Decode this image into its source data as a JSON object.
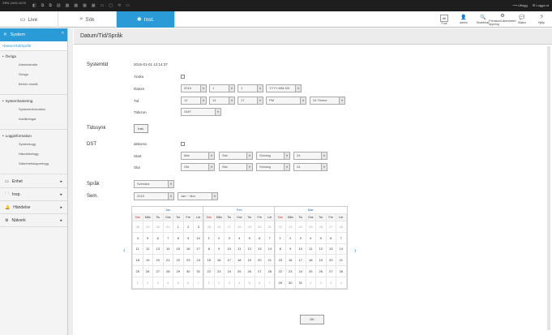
{
  "topbar": {
    "model": "SRN-1000-1678",
    "icons": [
      "◧",
      "⧉",
      "⧉",
      "▤",
      "▦",
      "▦",
      "▦",
      "▦",
      "▭",
      "▢",
      "⟲",
      "▭"
    ],
    "logout": "Utlogg",
    "user": "Logga ut"
  },
  "tabs": {
    "live": "Live",
    "search": "Sök",
    "setup": "Inst."
  },
  "tools": [
    {
      "name": "alt",
      "label": "Font",
      "glyph": "Alt"
    },
    {
      "name": "admin",
      "label": "admin",
      "glyph": "👤"
    },
    {
      "name": "search",
      "label": "Snabbinst.",
      "glyph": "🔍"
    },
    {
      "name": "tool",
      "label": "Premium/Låsenheter/öppning",
      "glyph": "⚙"
    },
    {
      "name": "status",
      "label": "Status",
      "glyph": "💬"
    },
    {
      "name": "help",
      "label": "Hjälp",
      "glyph": "?"
    }
  ],
  "sidebar": {
    "system": "System",
    "datetime": "Datum/Tid/Språk",
    "groups": [
      {
        "title": "Övriga",
        "items": [
          "Administratör",
          "Övriga",
          "Behörr inställ."
        ]
      },
      {
        "title": "Systemhantering",
        "items": [
          "Systeminformation",
          "Inställningar"
        ]
      },
      {
        "title": "Logginformation",
        "items": [
          "Systemlogg",
          "Händelselogg",
          "Säkerhetsloppertogg"
        ]
      }
    ],
    "sections": [
      {
        "label": "Enhet",
        "icon": "▭"
      },
      {
        "label": "Insp.",
        "icon": "🗀"
      },
      {
        "label": "Händelse",
        "icon": "🔔"
      },
      {
        "label": "Nätverk",
        "icon": "⚙"
      }
    ]
  },
  "page": {
    "title": "Datum/Tid/Språk",
    "systemtid": "Systemtid",
    "current": "2015-01-01 12:14:37",
    "andra": "Ändra",
    "datum": "Datum",
    "date_year": "2015",
    "date_month": "1",
    "date_day": "1",
    "date_fmt": "YYYY-MM-DD",
    "tid": "Tid",
    "time_h": "12",
    "time_m": "14",
    "time_s": "17",
    "time_ampm": "PM",
    "time_fmt": "24 Timme",
    "tidszon": "Tidszon",
    "tz": "GMT",
    "tidssynk": "Tidssynk",
    "inst": "Inst.",
    "dst": "DST",
    "aktivera": "aktivera",
    "start": "Start",
    "start_m": "Mar",
    "start_w": "Sist",
    "start_d": "Söndag",
    "start_h": "24",
    "slut": "Slut",
    "slut_m": "Okt",
    "slut_w": "Sist",
    "slut_d": "Söndag",
    "slut_h": "24",
    "sprak": "Språk",
    "sprak_val": "Svenska",
    "sem": "Sem.",
    "sem_year": "2015",
    "sem_range": "Jan ~ Mar",
    "ok": "OK"
  },
  "calendar": {
    "days": [
      "Sön",
      "Mån",
      "Tis",
      "Ons",
      "Tor",
      "Fre",
      "Lör"
    ],
    "months": [
      {
        "name": "Jan",
        "weeks": [
          [
            "28",
            "29",
            "30",
            "31",
            "1",
            "2",
            "3"
          ],
          [
            "4",
            "5",
            "6",
            "7",
            "8",
            "9",
            "10"
          ],
          [
            "11",
            "12",
            "13",
            "14",
            "15",
            "16",
            "17"
          ],
          [
            "18",
            "19",
            "20",
            "21",
            "22",
            "23",
            "24"
          ],
          [
            "25",
            "26",
            "27",
            "28",
            "29",
            "30",
            "31"
          ],
          [
            "1",
            "2",
            "3",
            "4",
            "5",
            "6",
            "7"
          ]
        ],
        "other": [
          [
            0,
            0
          ],
          [
            0,
            1
          ],
          [
            0,
            2
          ],
          [
            0,
            3
          ],
          [
            5,
            0
          ],
          [
            5,
            1
          ],
          [
            5,
            2
          ],
          [
            5,
            3
          ],
          [
            5,
            4
          ],
          [
            5,
            5
          ],
          [
            5,
            6
          ]
        ]
      },
      {
        "name": "Feb",
        "weeks": [
          [
            "25",
            "26",
            "27",
            "28",
            "29",
            "30",
            "31"
          ],
          [
            "1",
            "2",
            "3",
            "4",
            "5",
            "6",
            "7"
          ],
          [
            "8",
            "9",
            "10",
            "11",
            "12",
            "13",
            "14"
          ],
          [
            "15",
            "16",
            "17",
            "18",
            "19",
            "20",
            "21"
          ],
          [
            "22",
            "23",
            "24",
            "25",
            "26",
            "27",
            "28"
          ],
          [
            "1",
            "2",
            "3",
            "4",
            "5",
            "6",
            "7"
          ]
        ],
        "other": [
          [
            0,
            0
          ],
          [
            0,
            1
          ],
          [
            0,
            2
          ],
          [
            0,
            3
          ],
          [
            0,
            4
          ],
          [
            0,
            5
          ],
          [
            0,
            6
          ],
          [
            5,
            0
          ],
          [
            5,
            1
          ],
          [
            5,
            2
          ],
          [
            5,
            3
          ],
          [
            5,
            4
          ],
          [
            5,
            5
          ],
          [
            5,
            6
          ]
        ]
      },
      {
        "name": "Mar",
        "weeks": [
          [
            "22",
            "23",
            "24",
            "25",
            "26",
            "27",
            "28"
          ],
          [
            "1",
            "2",
            "3",
            "4",
            "5",
            "6",
            "7"
          ],
          [
            "8",
            "9",
            "10",
            "11",
            "12",
            "13",
            "14"
          ],
          [
            "15",
            "16",
            "17",
            "18",
            "19",
            "20",
            "21"
          ],
          [
            "22",
            "23",
            "24",
            "25",
            "26",
            "27",
            "28"
          ],
          [
            "29",
            "30",
            "31",
            "1",
            "2",
            "3",
            "4"
          ]
        ],
        "other": [
          [
            0,
            0
          ],
          [
            0,
            1
          ],
          [
            0,
            2
          ],
          [
            0,
            3
          ],
          [
            0,
            4
          ],
          [
            0,
            5
          ],
          [
            0,
            6
          ],
          [
            5,
            3
          ],
          [
            5,
            4
          ],
          [
            5,
            5
          ],
          [
            5,
            6
          ]
        ]
      }
    ],
    "prev": "‹",
    "next": "›"
  }
}
